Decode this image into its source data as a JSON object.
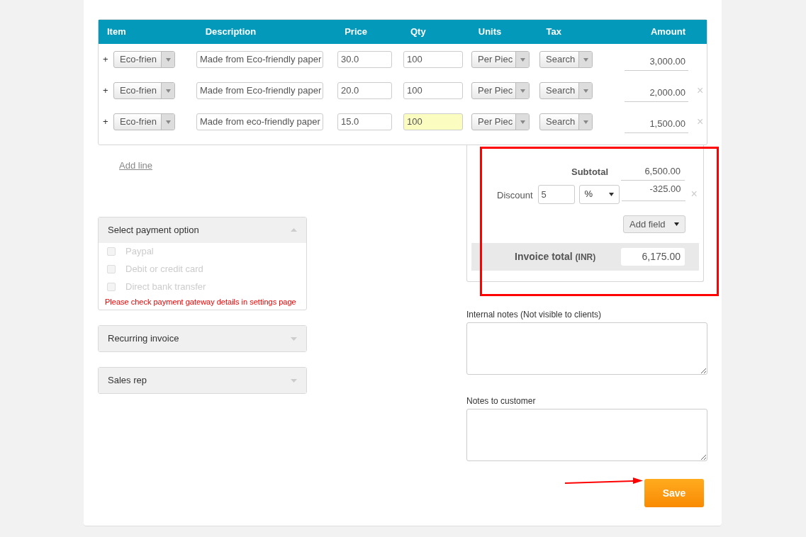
{
  "table": {
    "columns": [
      "Item",
      "Description",
      "Price",
      "Qty",
      "Units",
      "Tax",
      "Amount"
    ],
    "rows": [
      {
        "add": "+",
        "item": "Eco-frien",
        "description": "Made from Eco-friendly paper",
        "price": "30.0",
        "qty": "100",
        "qty_focused": false,
        "units": "Per Piec",
        "tax": "Search",
        "amount": "3,000.00"
      },
      {
        "add": "+",
        "item": "Eco-frien",
        "description": "Made from Eco-friendly paper",
        "price": "20.0",
        "qty": "100",
        "qty_focused": false,
        "units": "Per Piec",
        "tax": "Search",
        "amount": "2,000.00",
        "remove": "×"
      },
      {
        "add": "+",
        "item": "Eco-frien",
        "description": "Made from eco-friendly paper",
        "price": "15.0",
        "qty": "100",
        "qty_focused": true,
        "units": "Per Piec",
        "tax": "Search",
        "amount": "1,500.00",
        "remove": "×"
      }
    ]
  },
  "add_line": "Add line",
  "panels": [
    {
      "title": "Select payment option",
      "expanded": true,
      "options": [
        {
          "label": "Paypal",
          "checked": false,
          "disabled": true
        },
        {
          "label": "Debit or credit card",
          "checked": false,
          "disabled": true
        },
        {
          "label": "Direct bank transfer",
          "checked": false,
          "disabled": true
        }
      ],
      "warning": "Please check payment gateway details in settings page"
    },
    {
      "title": "Recurring invoice",
      "expanded": false
    },
    {
      "title": "Sales rep",
      "expanded": false
    }
  ],
  "totals": {
    "subtotal_label": "Subtotal",
    "subtotal": "6,500.00",
    "discount_label": "Discount",
    "discount_value": "5",
    "discount_type": "%",
    "discount_amount": "-325.00",
    "discount_remove": "×",
    "add_field": "Add field",
    "total_label": "Invoice total",
    "total_currency": "(INR)",
    "total": "6,175.00"
  },
  "notes": [
    {
      "label": "Internal notes (Not visible to clients)"
    },
    {
      "label": "Notes to customer"
    }
  ],
  "save": "Save"
}
